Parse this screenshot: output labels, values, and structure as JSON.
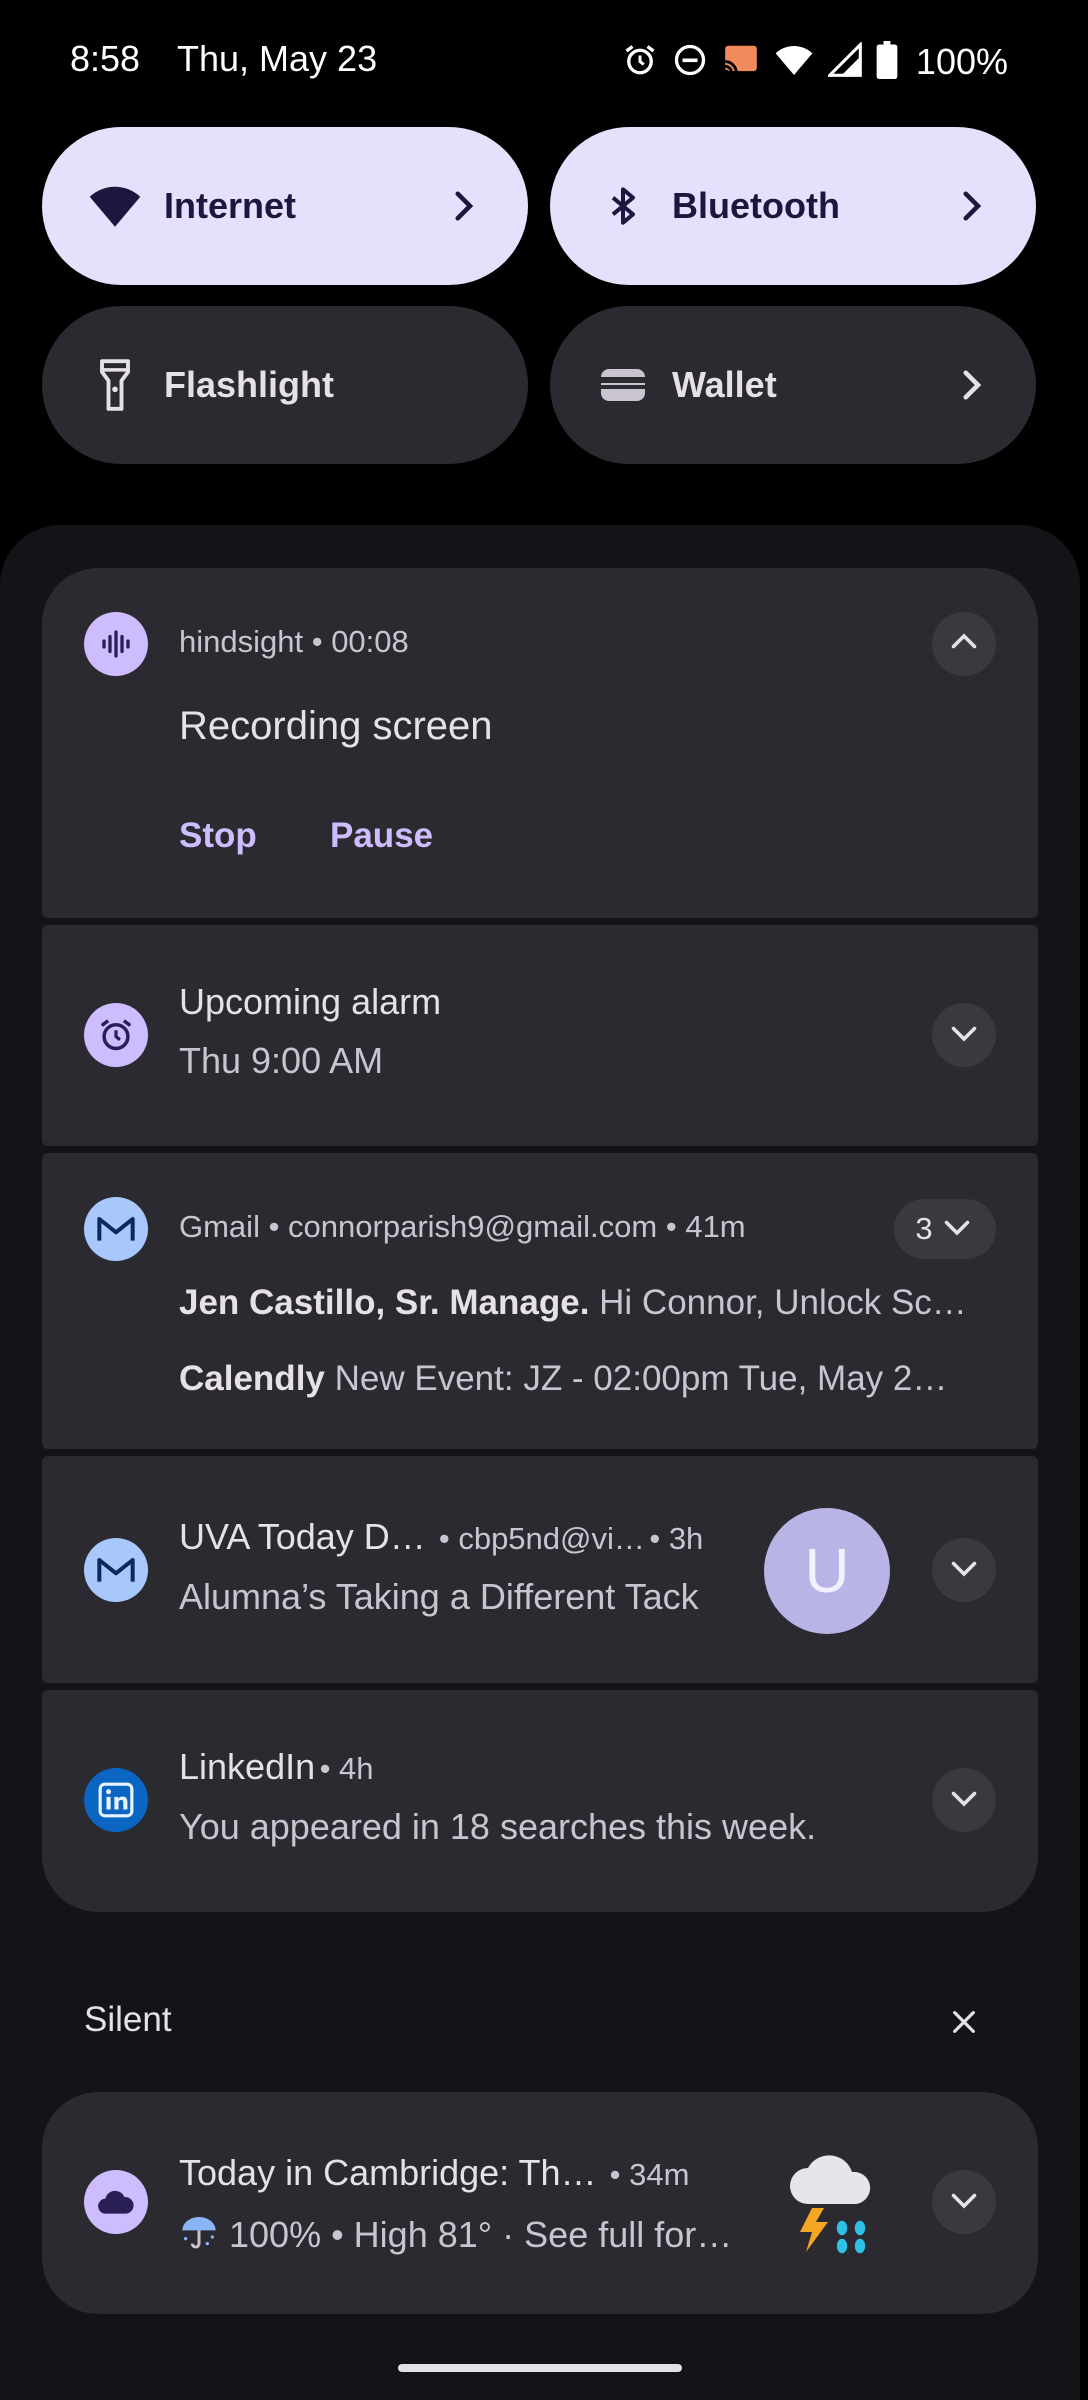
{
  "status": {
    "time": "8:58",
    "date": "Thu, May 23",
    "battery": "100%",
    "icons": [
      "alarm-icon",
      "do-not-disturb-icon",
      "cast-icon",
      "wifi-icon",
      "signal-icon",
      "battery-icon"
    ]
  },
  "tiles": [
    {
      "label": "Internet",
      "state": "on",
      "icon": "wifi-icon"
    },
    {
      "label": "Bluetooth",
      "state": "on",
      "icon": "bluetooth-icon"
    },
    {
      "label": "Flashlight",
      "state": "off",
      "icon": "flashlight-icon"
    },
    {
      "label": "Wallet",
      "state": "off",
      "icon": "wallet-icon"
    }
  ],
  "notifications": {
    "recording": {
      "app": "hindsight",
      "time": "00:08",
      "title": "Recording screen",
      "stop": "Stop",
      "pause": "Pause"
    },
    "alarm": {
      "title": "Upcoming alarm",
      "text": "Thu 9:00 AM"
    },
    "gmail": {
      "app": "Gmail",
      "account": "connorparish9@gmail.com",
      "time": "41m",
      "count": "3",
      "messages": [
        {
          "sender": "Jen Castillo, Sr. Manage.",
          "preview": "Hi Connor, Unlock Sc…"
        },
        {
          "sender": "Calendly",
          "preview": "New Event: JZ - 02:00pm Tue, May 2…"
        }
      ]
    },
    "uva": {
      "title": "UVA Today D…",
      "account": "cbp5nd@vi…",
      "time": "3h",
      "text": "Alumna’s Taking a Different Tack",
      "avatar": "U"
    },
    "linkedin": {
      "title": "LinkedIn",
      "time": "4h",
      "text": "You appeared in 18 searches this week."
    }
  },
  "silent": {
    "header": "Silent",
    "weather": {
      "title": "Today in Cambridge: Th…",
      "time": "34m",
      "text": "100% • High 81° · See full for…"
    }
  },
  "colors": {
    "tile_on": "#e7e0fc",
    "tile_off": "#2b2a30",
    "card": "#2b2a30",
    "accent": "#cdbdff",
    "linkedin": "#0a66c2"
  }
}
